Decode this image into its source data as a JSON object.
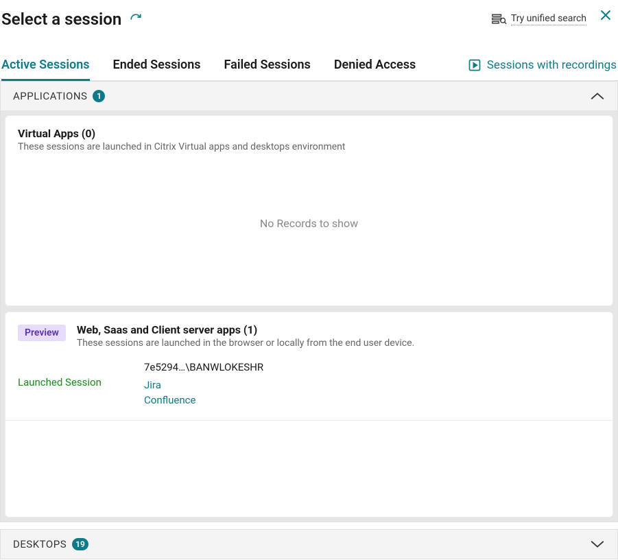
{
  "header": {
    "title": "Select a session",
    "unified_search": "Try unified search"
  },
  "tabs": {
    "active": "Active Sessions",
    "ended": "Ended Sessions",
    "failed": "Failed Sessions",
    "denied": "Denied Access",
    "recordings": "Sessions with recordings"
  },
  "accordions": {
    "applications": {
      "label": "APPLICATIONS",
      "count": "1"
    },
    "desktops": {
      "label": "DESKTOPS",
      "count": "19"
    }
  },
  "virtual_apps": {
    "title": "Virtual Apps (0)",
    "subtitle": "These sessions are launched in Citrix Virtual apps and desktops environment",
    "empty": "No Records to show"
  },
  "websaas": {
    "preview": "Preview",
    "title": "Web, Saas and Client server apps (1)",
    "subtitle": "These sessions are launched in the browser or locally from the end user device.",
    "launched_label": "Launched Session",
    "session_id": "7e5294…\\BANWLOKESHR",
    "apps": [
      "Jira",
      "Confluence"
    ]
  }
}
